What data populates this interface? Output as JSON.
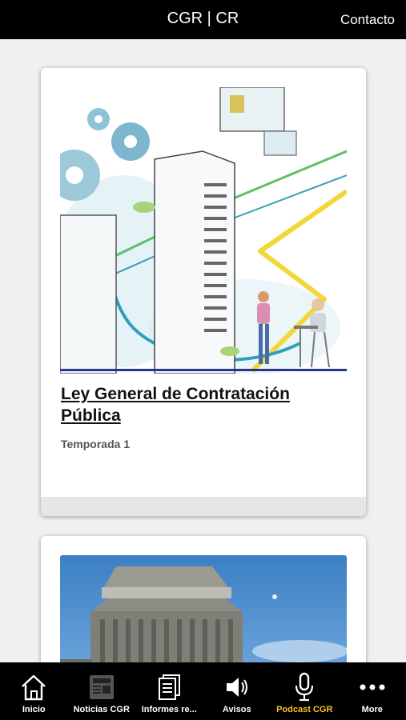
{
  "header": {
    "title": "CGR | CR",
    "contact_label": "Contacto"
  },
  "cards": [
    {
      "title": "Ley General de Contratación Pública",
      "subtitle": "Temporada 1"
    }
  ],
  "tabbar": {
    "tabs": [
      {
        "label": "Inicio",
        "icon": "home-icon"
      },
      {
        "label": "Noticias CGR",
        "icon": "newspaper-icon"
      },
      {
        "label": "Informes re...",
        "icon": "documents-icon"
      },
      {
        "label": "Avisos",
        "icon": "speaker-icon"
      },
      {
        "label": "Podcast CGR",
        "icon": "microphone-icon",
        "active": true
      },
      {
        "label": "More",
        "icon": "more-dots-icon"
      }
    ],
    "active_color": "#f5c518"
  }
}
